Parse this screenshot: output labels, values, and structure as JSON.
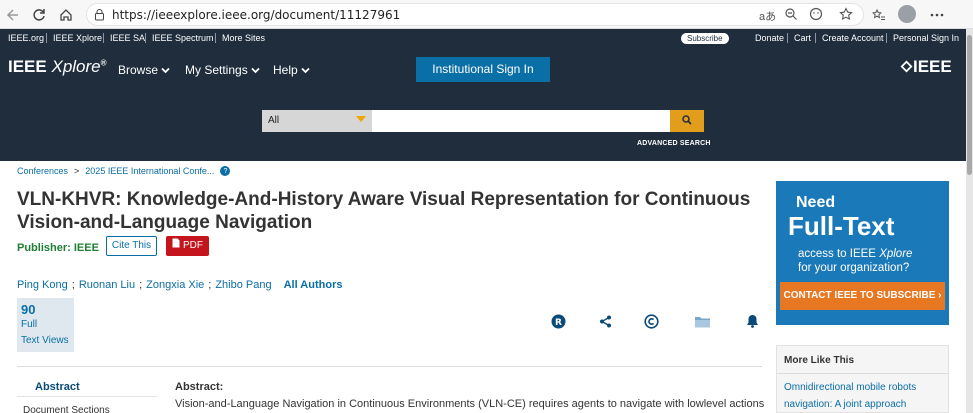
{
  "browser": {
    "url": "https://ieeexplore.ieee.org/document/11127961",
    "read_aloud": "aあ"
  },
  "topbar": {
    "links": [
      "IEEE.org",
      "IEEE Xplore",
      "IEEE SA",
      "IEEE Spectrum",
      "More Sites"
    ],
    "subscribe": "Subscribe",
    "right_links": [
      "Donate",
      "Cart",
      "Create Account",
      "Personal Sign In"
    ]
  },
  "header": {
    "brand_ieee": "IEEE",
    "brand_xplore": "Xplore",
    "brand_mark": "®",
    "menu": [
      "Browse",
      "My Settings",
      "Help"
    ],
    "institutional_sign_in": "Institutional Sign In",
    "logo": "IEEE",
    "search_scope": "All",
    "search_placeholder": "",
    "advanced_search": "ADVANCED SEARCH"
  },
  "breadcrumb": {
    "items": [
      "Conferences",
      "2025 IEEE International Confe..."
    ],
    "sep": ">",
    "help": "?"
  },
  "article": {
    "title": "VLN-KHVR: Knowledge-And-History Aware Visual Representation for Continuous Vision-and-Language Navigation",
    "publisher_label": "Publisher:",
    "publisher": "IEEE",
    "cite": "Cite This",
    "pdf": "PDF",
    "authors": [
      "Ping Kong",
      "Ruonan Liu",
      "Zongxia Xie",
      "Zhibo Pang"
    ],
    "author_sep": ";",
    "all_authors": "All Authors",
    "metric_value": "90",
    "metric_label_1": "Full",
    "metric_label_2": "Text Views"
  },
  "tools": [
    "rights-icon",
    "share-icon",
    "copyright-icon",
    "folder-icon",
    "alert-bell-icon"
  ],
  "nav": {
    "active": "Abstract",
    "next": "Document Sections"
  },
  "abstract": {
    "heading": "Abstract:",
    "text": "Vision-and-Language Navigation in Continuous Environments (VLN-CE) requires agents to navigate with lowlevel actions"
  },
  "ad": {
    "need": "Need",
    "full_text": "Full-Text",
    "access_pre": "access to IEEE ",
    "access_xplore": "Xplore",
    "access_post": "for your organization?",
    "cta": "CONTACT IEEE TO SUBSCRIBE ›"
  },
  "more_like_this": {
    "heading": "More Like This",
    "items": [
      "Omnidirectional mobile robots",
      "navigation: A joint approach"
    ]
  },
  "colors": {
    "ieee_navy": "#1f2d3d",
    "link_blue": "#0a6ea7",
    "pdf_red": "#c4151c",
    "search_orange": "#e39d1d",
    "cta_orange": "#e87722",
    "ad_blue": "#1a79b8"
  }
}
